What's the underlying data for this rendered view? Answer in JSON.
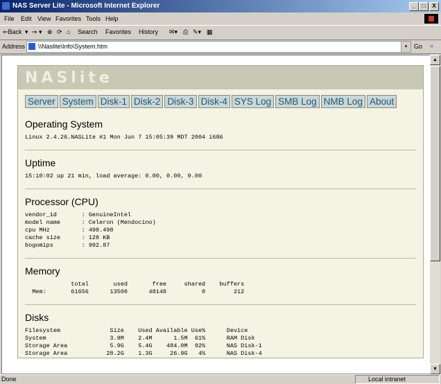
{
  "window": {
    "title": "NAS Server Lite - Microsoft Internet Explorer",
    "min_label": "_",
    "max_label": "□",
    "close_label": "X"
  },
  "menu": [
    "File",
    "Edit",
    "View",
    "Favorites",
    "Tools",
    "Help"
  ],
  "toolbar": {
    "back": "⇐Back",
    "back_drop": "▾",
    "forward": "⇒",
    "forward_drop": "▾",
    "stop": "⊗",
    "refresh": "⟳",
    "home": "⌂",
    "search": "Search",
    "favorites": "Favorites",
    "history": "History",
    "mail": "✉▾",
    "print": "⎙",
    "edit": "✎▾",
    "discuss": "▦"
  },
  "address": {
    "label": "Address",
    "value": "\\\\Naslite\\Info\\System.htm",
    "drop": "▾",
    "go": "Go",
    "links": "»"
  },
  "nas": {
    "logo": "NASlite",
    "nav": [
      "Server",
      "System",
      "Disk-1",
      "Disk-2",
      "Disk-3",
      "Disk-4",
      "SYS Log",
      "SMB Log",
      "NMB Log",
      "About"
    ],
    "sections": [
      {
        "title": "Operating System",
        "body": "Linux 2.4.26.NASLite #1 Mon Jun 7 15:05:39 MDT 2004 i686"
      },
      {
        "title": "Uptime",
        "body": "15:10:02 up 21 min, load average: 0.00, 0.00, 0.00"
      },
      {
        "title": "Processor (CPU)",
        "body": "vendor_id       : GenuineIntel\nmodel name      : Celeron (Mendocino)\ncpu MHz         : 498.498\ncache size      : 128 KB\nbogomips        : 992.87"
      },
      {
        "title": "Memory",
        "body": "             total       used       free     shared    buffers\n  Mem:       61656      13508      48148          0        212"
      },
      {
        "title": "Disks",
        "body": "Filesystem              Size    Used Available Use%      Device\nSystem                  3.9M    2.4M      1.5M  61%      RAM Disk\nStorage Area            5.9G    5.4G    484.0M  92%      NAS Disk-1\nStorage Area           28.2G    1.3G     26.9G   4%      NAS Disk-4"
      }
    ]
  },
  "status": {
    "left": "Done",
    "zone": "Local intranet"
  }
}
